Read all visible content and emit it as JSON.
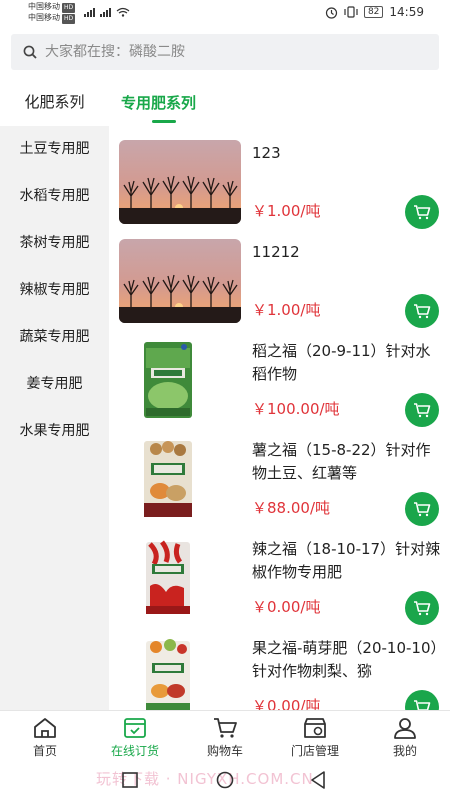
{
  "status_bar": {
    "carrier1": "中国移动",
    "carrier2": "中国移动",
    "hd": "HD",
    "network": "4G 5G",
    "battery": "82",
    "time": "14:59"
  },
  "search": {
    "placeholder": "大家都在搜：磷酸二胺"
  },
  "sidebar": {
    "header": "化肥系列",
    "items": [
      {
        "label": "土豆专用肥"
      },
      {
        "label": "水稻专用肥"
      },
      {
        "label": "茶树专用肥"
      },
      {
        "label": "辣椒专用肥"
      },
      {
        "label": "蔬菜专用肥"
      },
      {
        "label": "姜专用肥"
      },
      {
        "label": "水果专用肥"
      }
    ]
  },
  "main": {
    "tab_label": "专用肥系列",
    "products": [
      {
        "name": "123",
        "price": "￥1.00/吨",
        "image": "sunset-trees-photo"
      },
      {
        "name": "11212",
        "price": "￥1.00/吨",
        "image": "sunset-trees-photo"
      },
      {
        "name": "稻之福（20-9-11）针对水稻作物",
        "price": "￥100.00/吨",
        "image": "fertilizer-bag-green"
      },
      {
        "name": "薯之福（15-8-22）针对作物土豆、红薯等",
        "price": "￥88.00/吨",
        "image": "fertilizer-bag-brown"
      },
      {
        "name": "辣之福（18-10-17）针对辣椒作物专用肥",
        "price": "￥0.00/吨",
        "image": "fertilizer-bag-red"
      },
      {
        "name": "果之福-萌芽肥（20-10-10）针对作物刺梨、猕",
        "price": "￥0.00/吨",
        "image": "fertilizer-bag-orange"
      }
    ]
  },
  "tabbar": {
    "items": [
      {
        "label": "首页",
        "icon": "home-icon"
      },
      {
        "label": "在线订货",
        "icon": "order-icon"
      },
      {
        "label": "购物车",
        "icon": "cart-icon"
      },
      {
        "label": "门店管理",
        "icon": "store-icon"
      },
      {
        "label": "我的",
        "icon": "user-icon"
      }
    ]
  },
  "watermark": "玩转下载 · NIGYXH.COM.CN",
  "colors": {
    "accent": "#19a84a",
    "price": "#e0343a",
    "sidebar_bg": "#f2f2f2"
  }
}
